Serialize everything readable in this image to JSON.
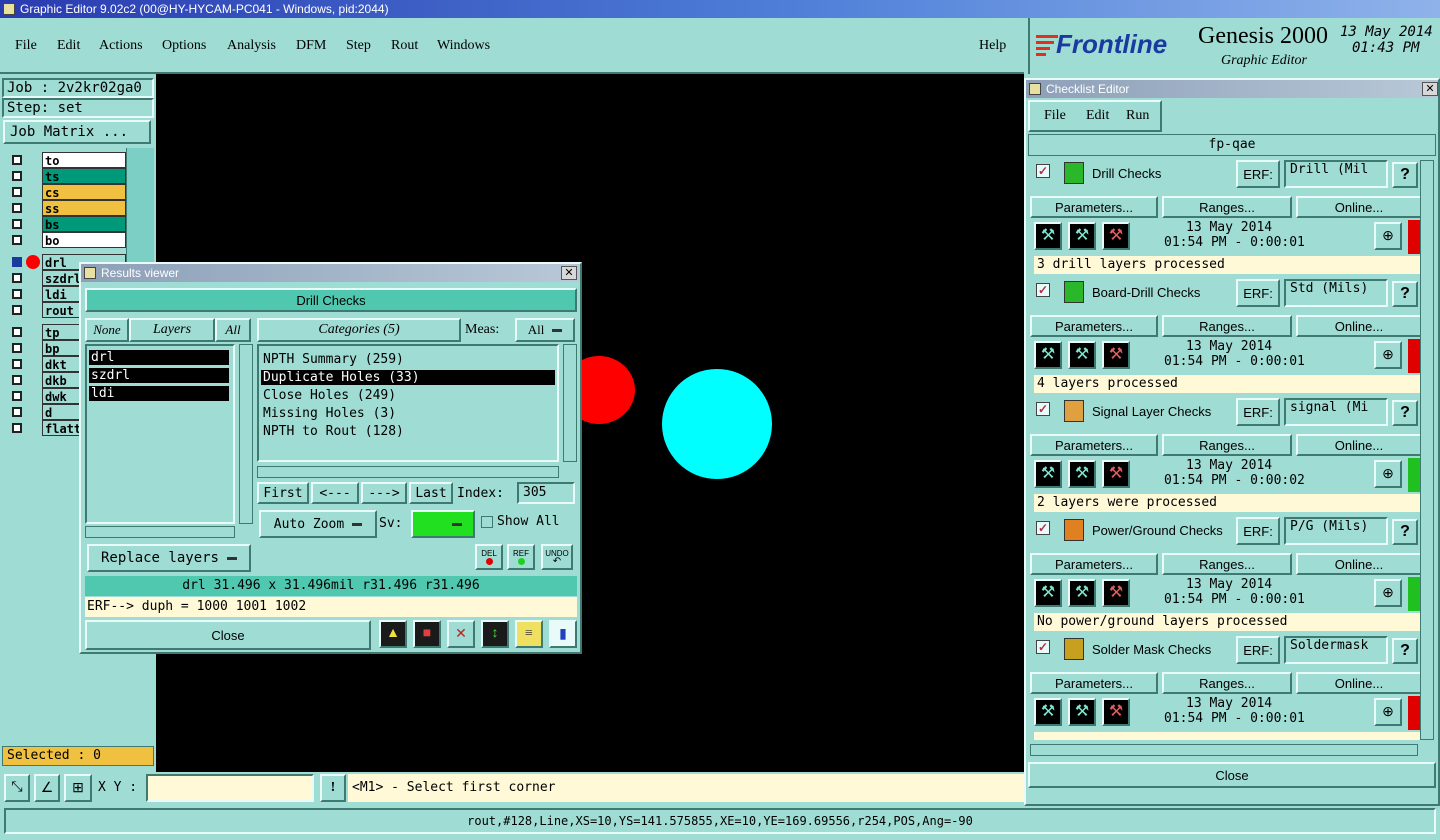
{
  "window": {
    "title": "Graphic Editor 9.02c2 (00@HY-HYCAM-PC041 - Windows, pid:2044)"
  },
  "menu": {
    "items": [
      "File",
      "Edit",
      "Actions",
      "Options",
      "Analysis",
      "DFM",
      "Step",
      "Rout",
      "Windows"
    ],
    "help": "Help"
  },
  "brand": {
    "logo": "Frontline",
    "product": "Genesis 2000",
    "subtitle": "Graphic Editor",
    "date": "13 May 2014",
    "time": "01:43 PM"
  },
  "left": {
    "job": "Job : 2v2kr02ga0",
    "step": "Step: set",
    "job_matrix": "Job Matrix ...",
    "layers_group1": [
      {
        "name": "to",
        "color": "#ffffff"
      },
      {
        "name": "ts",
        "color": "#009a7a"
      },
      {
        "name": "cs",
        "color": "#f0c040"
      },
      {
        "name": "ss",
        "color": "#f0c040"
      },
      {
        "name": "bs",
        "color": "#009a7a"
      },
      {
        "name": "bo",
        "color": "#ffffff"
      }
    ],
    "layers_group2": [
      {
        "name": "drl"
      },
      {
        "name": "szdrl"
      },
      {
        "name": "ldi"
      },
      {
        "name": "rout"
      }
    ],
    "layers_group3": [
      {
        "name": "tp"
      },
      {
        "name": "bp"
      },
      {
        "name": "dkt"
      },
      {
        "name": "dkb"
      },
      {
        "name": "dwk"
      },
      {
        "name": "d"
      },
      {
        "name": "flatte"
      }
    ],
    "selected": "Selected : 0"
  },
  "status": {
    "xy_label": "X Y :",
    "xy_value": "",
    "hint": "<M1> - Select first corner",
    "bottom": "rout,#128,Line,XS=10,YS=141.575855,XE=10,YE=169.69556,r254,POS,Ang=-90"
  },
  "results": {
    "title": "Results viewer",
    "check_name": "Drill Checks",
    "none_label": "None",
    "layers_label": "Layers",
    "all_label": "All",
    "categories_label": "Categories (5)",
    "meas_label": "Meas:",
    "meas_value": "All",
    "layers": [
      "drl",
      "szdrl",
      "ldi"
    ],
    "categories": [
      "NPTH Summary (259)",
      "Duplicate Holes (33)",
      "Close Holes (249)",
      "Missing Holes (3)",
      "NPTH to Rout (128)"
    ],
    "first": "First",
    "prev": "<---",
    "next": "--->",
    "last": "Last",
    "index_label": "Index:",
    "index_value": "305",
    "auto_zoom": "Auto Zoom",
    "sv_label": "Sv:",
    "show_all": "Show All",
    "replace_layers": "Replace layers",
    "del": "DEL",
    "ref": "REF",
    "undo": "UNDO",
    "measure": "drl 31.496 x 31.496mil  r31.496  r31.496",
    "erf": "ERF--> duph = 1000 1001 1002",
    "close": "Close"
  },
  "checklist": {
    "title": "Checklist Editor",
    "menu": [
      "File",
      "Edit",
      "Run"
    ],
    "name": "fp-qae",
    "erf_label": "ERF:",
    "params": "Parameters...",
    "ranges": "Ranges...",
    "online": "Online...",
    "close": "Close",
    "checks": [
      {
        "name": "Drill Checks",
        "erf": "Drill (Mil",
        "date": "13 May 2014",
        "time": "01:54 PM - 0:00:01",
        "result": "3 drill layers processed",
        "status_color": "#e00000",
        "icon_color": "#2ab82a"
      },
      {
        "name": "Board-Drill Checks",
        "erf": "Std (Mils)",
        "date": "13 May 2014",
        "time": "01:54 PM - 0:00:01",
        "result": "4 layers processed",
        "status_color": "#e00000",
        "icon_color": "#2ab82a"
      },
      {
        "name": "Signal Layer Checks",
        "erf": "signal (Mi",
        "date": "13 May 2014",
        "time": "01:54 PM - 0:00:02",
        "result": "2 layers were processed",
        "status_color": "#20c020",
        "icon_color": "#e0a040"
      },
      {
        "name": "Power/Ground Checks",
        "erf": "P/G (Mils)",
        "date": "13 May 2014",
        "time": "01:54 PM - 0:00:01",
        "result": "No power/ground layers processed",
        "status_color": "#20c020",
        "icon_color": "#e08020"
      },
      {
        "name": "Solder Mask Checks",
        "erf": "Soldermask",
        "date": "13 May 2014",
        "time": "01:54 PM - 0:00:01",
        "result": "",
        "status_color": "#e00000",
        "icon_color": "#c8a020"
      }
    ]
  }
}
